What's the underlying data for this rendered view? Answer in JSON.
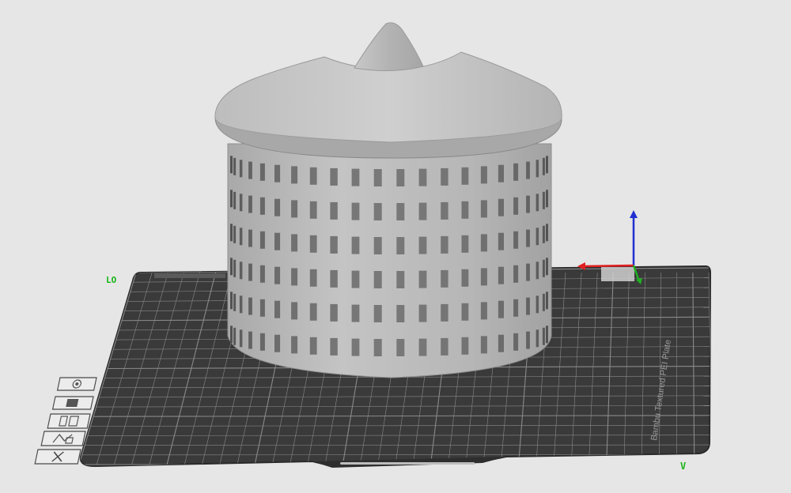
{
  "viewport": {
    "background": "#e6e6e6",
    "bed_color": "#3a3a3a",
    "grid_color": "#8a8a8a",
    "model_color": "#b8b8b8"
  },
  "bed": {
    "corner_label": "LO",
    "side_text": "Bambu Textured PEI Plate"
  },
  "axes": {
    "x_color": "#e02020",
    "y_color": "#20b020",
    "z_color": "#2030d0"
  },
  "toolbar": {
    "items": [
      {
        "name": "orient-icon"
      },
      {
        "name": "arrange-icon"
      },
      {
        "name": "plate-settings-icon"
      },
      {
        "name": "auto-arrange-icon"
      },
      {
        "name": "delete-plate-icon"
      }
    ]
  }
}
